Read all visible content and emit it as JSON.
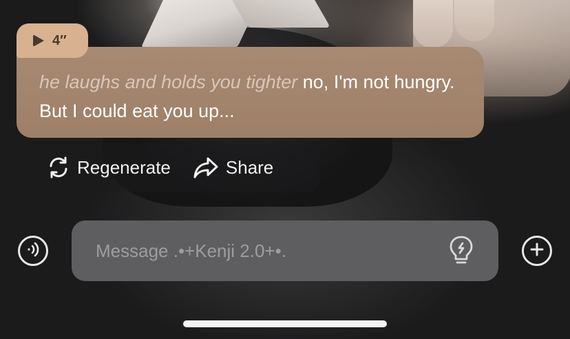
{
  "audio": {
    "duration": "4″"
  },
  "message": {
    "narration": "he laughs and holds you tighter",
    "spoken": " no, I'm not hungry. But I could eat you up..."
  },
  "actions": {
    "regenerate_label": "Regenerate",
    "share_label": "Share"
  },
  "composer": {
    "placeholder": "Message .•+Kenji 2.0+•.",
    "value": ""
  },
  "icons": {
    "audio_play": "play-icon",
    "regenerate": "refresh-icon",
    "share": "share-arrow-icon",
    "voice": "voice-call-icon",
    "hint": "lightbulb-icon",
    "add": "plus-icon"
  },
  "colors": {
    "bubble": "#a88a73",
    "audio_badge": "#d8b290",
    "input_bg": "#5e5e60"
  }
}
